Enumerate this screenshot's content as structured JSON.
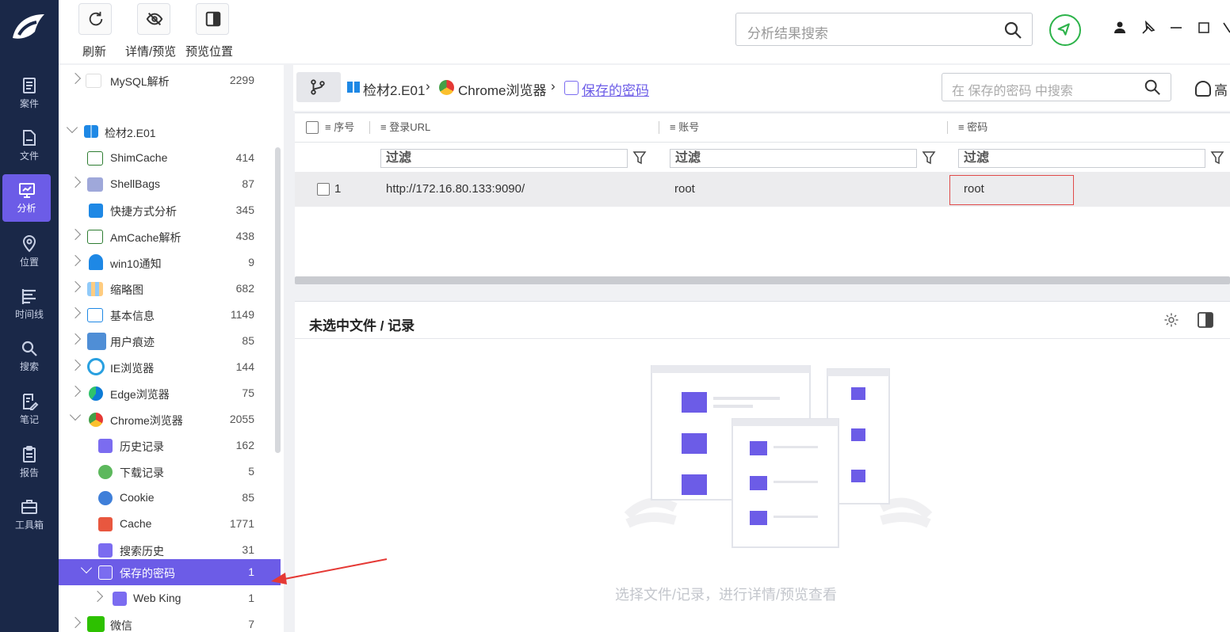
{
  "nav_rail": {
    "items": [
      {
        "label": "案件",
        "icon": "case-icon"
      },
      {
        "label": "文件",
        "icon": "file-icon"
      },
      {
        "label": "分析",
        "icon": "analysis-icon",
        "active": true
      },
      {
        "label": "位置",
        "icon": "location-icon"
      },
      {
        "label": "时间线",
        "icon": "timeline-icon"
      },
      {
        "label": "搜索",
        "icon": "search-icon"
      },
      {
        "label": "笔记",
        "icon": "notes-icon"
      },
      {
        "label": "报告",
        "icon": "report-icon"
      },
      {
        "label": "工具箱",
        "icon": "toolbox-icon"
      }
    ],
    "accent": "#6c5ce7",
    "bg": "#1a2848"
  },
  "toolbar": {
    "refresh_label": "刷新",
    "detail_preview_label": "详情/预览",
    "preview_position_label": "预览位置"
  },
  "global_search": {
    "placeholder": "分析结果搜索"
  },
  "tree": {
    "items": [
      {
        "label": "MySQL解析",
        "count": "2299"
      },
      {
        "label": "检材2.E01",
        "count": ""
      },
      {
        "label": "ShimCache",
        "count": "414"
      },
      {
        "label": "ShellBags",
        "count": "87"
      },
      {
        "label": "快捷方式分析",
        "count": "345"
      },
      {
        "label": "AmCache解析",
        "count": "438"
      },
      {
        "label": "win10通知",
        "count": "9"
      },
      {
        "label": "缩略图",
        "count": "682"
      },
      {
        "label": "基本信息",
        "count": "1149"
      },
      {
        "label": "用户痕迹",
        "count": "85"
      },
      {
        "label": "IE浏览器",
        "count": "144"
      },
      {
        "label": "Edge浏览器",
        "count": "75"
      },
      {
        "label": "Chrome浏览器",
        "count": "2055"
      },
      {
        "label": "历史记录",
        "count": "162"
      },
      {
        "label": "下载记录",
        "count": "5"
      },
      {
        "label": "Cookie",
        "count": "85"
      },
      {
        "label": "Cache",
        "count": "1771"
      },
      {
        "label": "搜索历史",
        "count": "31"
      },
      {
        "label": "保存的密码",
        "count": "1"
      },
      {
        "label": "Web King",
        "count": "1"
      },
      {
        "label": "微信",
        "count": "7"
      }
    ]
  },
  "breadcrumb": {
    "items": [
      "检材2.E01",
      "Chrome浏览器",
      "保存的密码"
    ],
    "separator": "›"
  },
  "inner_search": {
    "placeholder": "在 保存的密码 中搜索"
  },
  "advanced_label": "高",
  "grid": {
    "columns": [
      "序号",
      "登录URL",
      "账号",
      "密码"
    ],
    "filter_placeholder": "过滤",
    "rows": [
      {
        "index": "1",
        "url": "http://172.16.80.133:9090/",
        "account": "root",
        "password": "root"
      }
    ]
  },
  "detail": {
    "title": "未选中文件 / 记录",
    "empty_message": "选择文件/记录，进行详情/预览查看"
  }
}
